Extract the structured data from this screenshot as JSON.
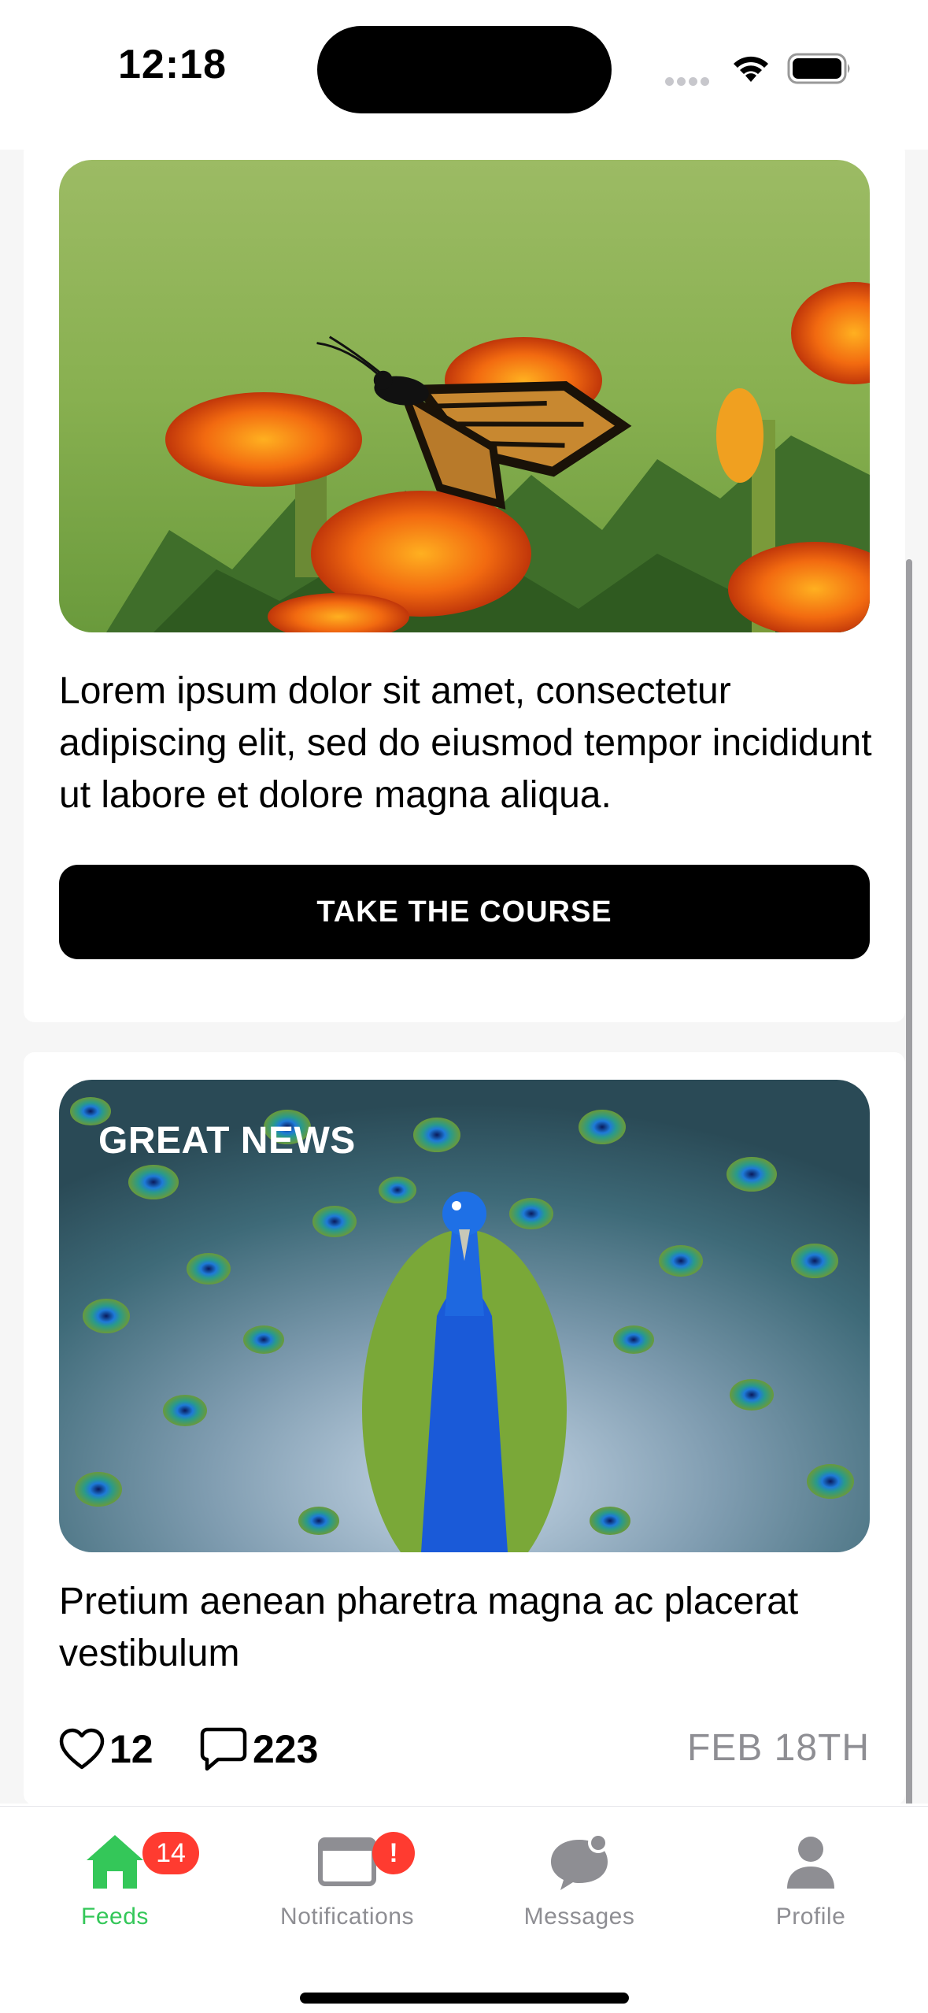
{
  "status_bar": {
    "time": "12:18",
    "icons": [
      "cellular-signal-icon",
      "wifi-icon",
      "battery-icon"
    ]
  },
  "feed": {
    "cards": [
      {
        "image": "monarch-butterfly-on-marigolds",
        "text": "Lorem ipsum dolor sit amet, consectetur adipiscing elit, sed do eiusmod tempor incididunt ut labore et dolore magna aliqua.",
        "button_label": "TAKE THE COURSE"
      },
      {
        "image": "peacock-displaying-feathers",
        "badge_text": "GREAT NEWS",
        "text": "Pretium aenean pharetra magna ac placerat vestibulum",
        "likes": "12",
        "comments": "223",
        "date": "FEB 18TH"
      }
    ]
  },
  "tab_bar": {
    "accent_color": "#34c759",
    "badge_color": "#ff3b30",
    "tabs": [
      {
        "label": "Feeds",
        "icon": "home-icon",
        "badge": "14",
        "active": true
      },
      {
        "label": "Notifications",
        "icon": "window-icon",
        "badge": "!",
        "active": false
      },
      {
        "label": "Messages",
        "icon": "chat-bubble-icon",
        "active": false
      },
      {
        "label": "Profile",
        "icon": "person-icon",
        "active": false
      }
    ]
  }
}
